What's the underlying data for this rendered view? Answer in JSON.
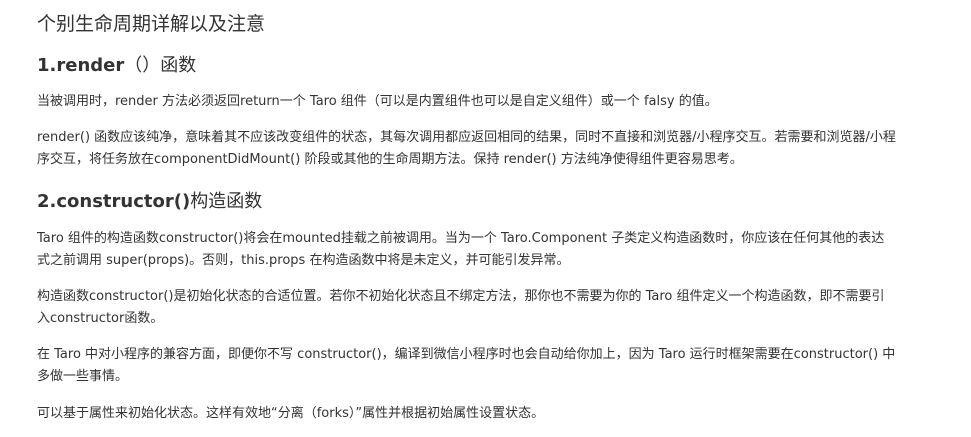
{
  "page_title": "个别生命周期详解以及注意",
  "sections": [
    {
      "heading_bold": "1.render",
      "heading_light": "（）函数",
      "paragraphs": [
        "当被调用时，render 方法必须返回return一个 Taro 组件（可以是内置组件也可以是自定义组件）或一个 falsy 的值。",
        "render() 函数应该纯净，意味着其不应该改变组件的状态，其每次调用都应返回相同的结果，同时不直接和浏览器/小程序交互。若需要和浏览器/小程序交互，将任务放在componentDidMount() 阶段或其他的生命周期方法。保持 render() 方法纯净使得组件更容易思考。"
      ]
    },
    {
      "heading_bold": "2.constructor()",
      "heading_light": "构造函数",
      "paragraphs": [
        "Taro 组件的构造函数constructor()将会在mounted挂载之前被调用。当为一个 Taro.Component 子类定义构造函数时，你应该在任何其他的表达式之前调用 super(props)。否则，this.props 在构造函数中将是未定义，并可能引发异常。",
        "构造函数constructor()是初始化状态的合适位置。若你不初始化状态且不绑定方法，那你也不需要为你的 Taro 组件定义一个构造函数，即不需要引入constructor函数。",
        "在 Taro 中对小程序的兼容方面，即便你不写 constructor()，编译到微信小程序时也会自动给你加上，因为 Taro 运行时框架需要在constructor() 中多做一些事情。",
        "可以基于属性来初始化状态。这样有效地“分离（forks）”属性并根据初始属性设置状态。"
      ]
    }
  ]
}
